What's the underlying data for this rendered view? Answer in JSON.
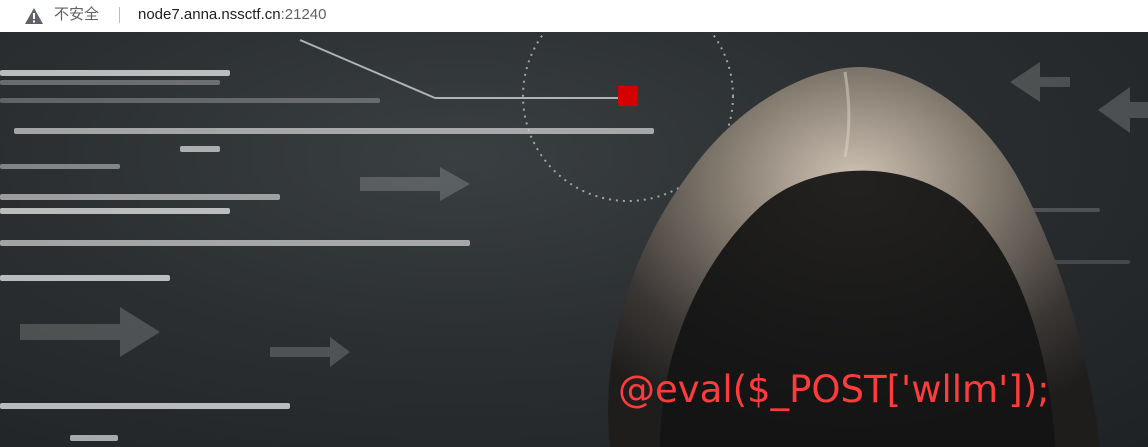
{
  "browser": {
    "security_label": "不安全",
    "url_host": "node7.anna.nssctf.cn",
    "url_port": ":21240",
    "warning_icon": "warning-triangle-icon"
  },
  "page": {
    "payload_text": "@eval($_POST['wllm']);",
    "payload_color": "#ff3c3c",
    "accent_square_color": "#d40000",
    "background_theme": "hacker-hood-code"
  }
}
